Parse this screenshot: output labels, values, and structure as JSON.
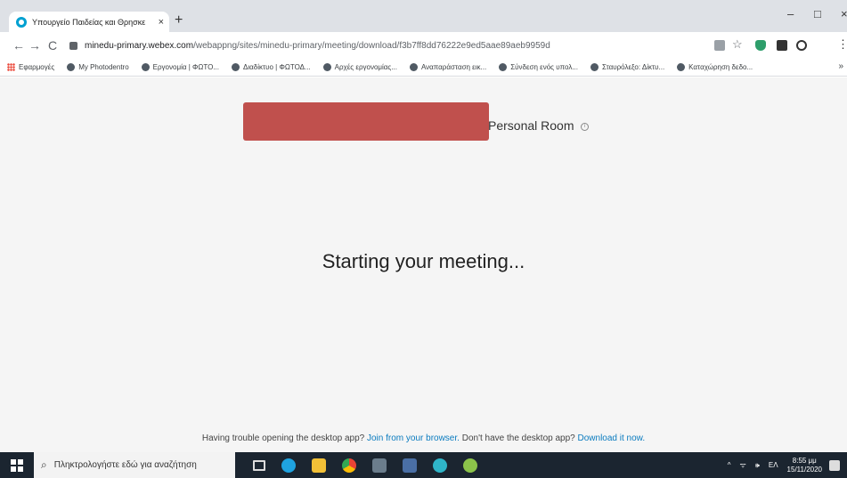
{
  "browser": {
    "tab_title": "Υπουργείο Παιδείας και Θρησκε",
    "tab_close": "×",
    "new_tab": "+",
    "window_controls": {
      "minimize": "–",
      "maximize": "□",
      "close": "×"
    },
    "nav": {
      "back": "←",
      "forward": "→",
      "reload": "C"
    },
    "url_host": "minedu-primary.webex.com",
    "url_path": "/webappng/sites/minedu-primary/meeting/download/f3b7ff8dd76222e9ed5aae89aeb9959d",
    "toolbar_icons": {
      "star": "☆",
      "menu": "⋮"
    }
  },
  "bookmarks": [
    {
      "label": "Εφαρμογές",
      "icon": "apps-icon"
    },
    {
      "label": "My Photodentro",
      "icon": "photodentro-icon"
    },
    {
      "label": "Εργονομία | ΦΩΤΟ...",
      "icon": "globe-icon"
    },
    {
      "label": "Διαδίκτυο | ΦΩΤΟΔ...",
      "icon": "globe-icon"
    },
    {
      "label": "Αρχές εργονομίας...",
      "icon": "globe-icon"
    },
    {
      "label": "Αναπαράσταση εικ...",
      "icon": "globe-icon"
    },
    {
      "label": "Σύνδεση ενός υπολ...",
      "icon": "globe-icon"
    },
    {
      "label": "Σταυρόλεξο: Δίκτυ...",
      "icon": "globe-icon"
    },
    {
      "label": "Καταχώρηση δεδο...",
      "icon": "globe-icon"
    }
  ],
  "bookmarks_more": "»",
  "page": {
    "room_title": "Personal Room",
    "info_glyph": "i",
    "status": "Starting your meeting...",
    "help_prefix": "Having trouble opening the desktop app?",
    "join_link": "Join from your browser.",
    "help_middle": "Don't have the desktop app?",
    "download_link": "Download it now."
  },
  "taskbar": {
    "search_placeholder": "Πληκτρολογήστε εδώ για αναζήτηση",
    "search_glyph": "⌕",
    "tray_chevron": "^",
    "tray_network": "ᯤ",
    "tray_volume": "🕪",
    "language": "ΕΛ",
    "time": "8:55 μμ",
    "date": "15/11/2020"
  },
  "colors": {
    "link": "#0a7bbf",
    "redaction": "#c0504d",
    "taskbar": "#1b2530"
  }
}
